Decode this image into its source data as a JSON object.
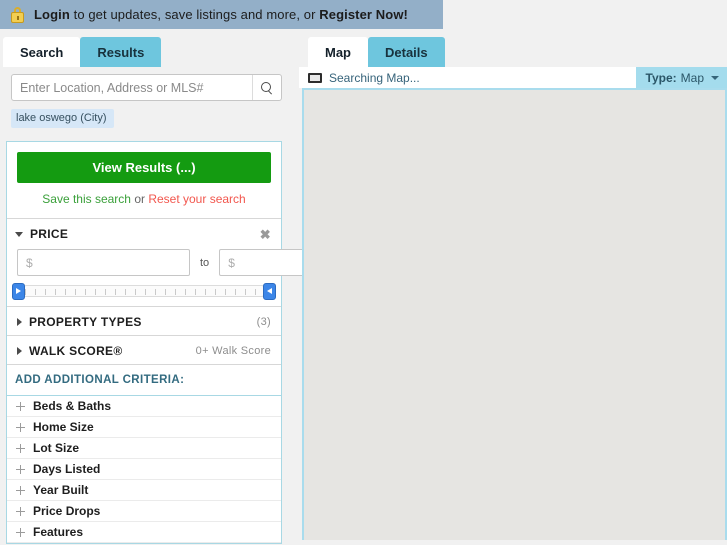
{
  "banner": {
    "icon": "lock-icon",
    "login_label": "Login",
    "middle_text": " to get updates, save listings and more, or ",
    "register_label": "Register Now!"
  },
  "left_tabs": [
    {
      "label": "Search",
      "active": true
    },
    {
      "label": "Results",
      "active": false
    }
  ],
  "search": {
    "placeholder": "Enter Location, Address or MLS#",
    "value": "",
    "icon": "search-icon",
    "chips": [
      {
        "label": "lake oswego (City)"
      }
    ]
  },
  "filters": {
    "view_results_label": "View Results (...)",
    "save_label": "Save this search",
    "or_label": " or ",
    "reset_label": "Reset your search",
    "price": {
      "title": "PRICE",
      "min_placeholder": "$",
      "min_value": "",
      "to_label": "to",
      "max_placeholder": "$",
      "max_value": "",
      "close_glyph": "✖"
    },
    "property_types": {
      "title": "PROPERTY TYPES",
      "count": "(3)"
    },
    "walk_score": {
      "title": "WALK SCORE®",
      "meta": "0+ Walk Score"
    },
    "add_criteria_label": "ADD ADDITIONAL CRITERIA:",
    "criteria": [
      {
        "label": "Beds & Baths"
      },
      {
        "label": "Home Size"
      },
      {
        "label": "Lot Size"
      },
      {
        "label": "Days Listed"
      },
      {
        "label": "Year Built"
      },
      {
        "label": "Price Drops"
      },
      {
        "label": "Features"
      }
    ]
  },
  "right_tabs": [
    {
      "label": "Map",
      "active": true
    },
    {
      "label": "Details",
      "active": false
    }
  ],
  "map": {
    "status_text": "Searching Map...",
    "type_prefix": "Type:",
    "type_value": "Map"
  },
  "colors": {
    "banner_bg": "#93afc8",
    "tab_inactive": "#6ec6de",
    "primary_green": "#149b11",
    "save_green": "#3aa03a",
    "reset_red": "#f2574e",
    "panel_border": "#a8d8e4",
    "type_bg": "#a4dced",
    "map_bg": "#e6e5e2",
    "slider_handle": "#3c86e8"
  }
}
